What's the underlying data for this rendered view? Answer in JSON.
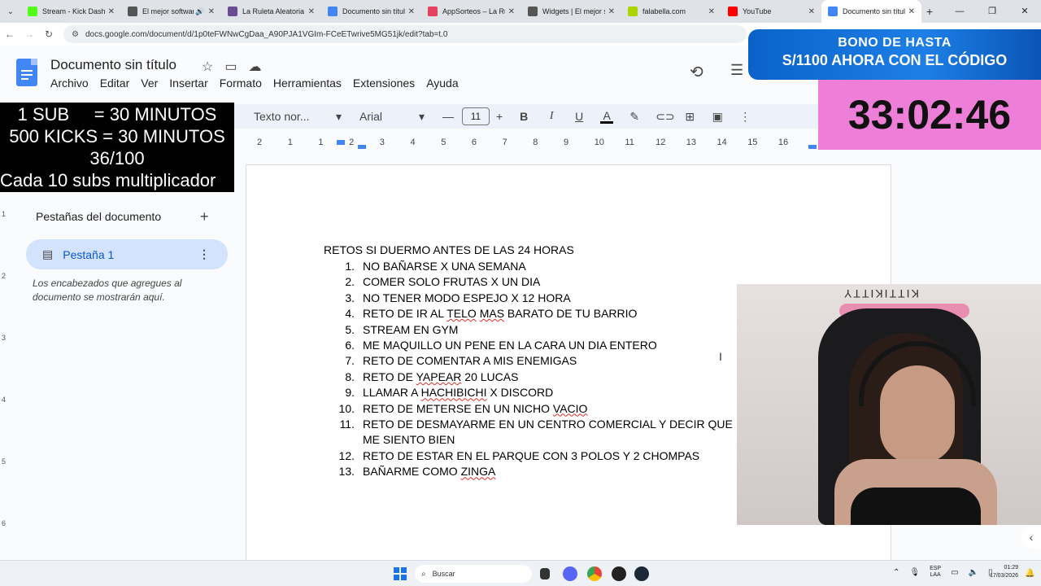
{
  "browser": {
    "tabs": [
      {
        "label": "Stream - Kick Dashbo",
        "fav_color": "#53fc18",
        "active": false
      },
      {
        "label": "El mejor software",
        "fav_color": "#555555",
        "active": false,
        "audio": true
      },
      {
        "label": "La Ruleta Aleatoria",
        "fav_color": "#6a4c93",
        "active": false
      },
      {
        "label": "Documento sin título",
        "fav_color": "#4285f4",
        "active": false
      },
      {
        "label": "AppSorteos – La Rule",
        "fav_color": "#e4405f",
        "active": false
      },
      {
        "label": "Widgets | El mejor so",
        "fav_color": "#555555",
        "active": false
      },
      {
        "label": "falabella.com",
        "fav_color": "#aad500",
        "active": false
      },
      {
        "label": "YouTube",
        "fav_color": "#ff0000",
        "active": false
      },
      {
        "label": "Documento sin título",
        "fav_color": "#4285f4",
        "active": true
      }
    ],
    "url": "docs.google.com/document/d/1p0teFWNwCgDaa_A90PJA1VGIm-FCeETwrive5MG51jk/edit?tab=t.0"
  },
  "docs": {
    "title": "Documento sin título",
    "menu": [
      "Archivo",
      "Editar",
      "Ver",
      "Insertar",
      "Formato",
      "Herramientas",
      "Extensiones",
      "Ayuda"
    ],
    "toolbar": {
      "style": "Texto nor...",
      "font": "Arial",
      "size": "11"
    },
    "ruler_numbers": [
      "2",
      "1",
      "1",
      "2",
      "3",
      "4",
      "5",
      "6",
      "7",
      "8",
      "9",
      "10",
      "11",
      "12",
      "13",
      "14",
      "15",
      "16"
    ],
    "side_panel": {
      "title": "Pestañas del documento",
      "tab_label": "Pestaña 1",
      "hint": "Los encabezados que agregues al documento se mostrarán aquí."
    },
    "heading": "RETOS SI DUERMO ANTES DE LAS 24 HORAS",
    "items": [
      "NO BAÑARSE X UNA SEMANA",
      "COMER SOLO FRUTAS X UN DIA",
      "NO TENER MODO ESPEJO X 12 HORA",
      "RETO DE IR AL TELO MAS BARATO DE TU BARRIO",
      "STREAM EN GYM",
      "ME MAQUILLO UN PENE EN LA CARA UN DIA ENTERO",
      "RETO DE COMENTAR A MIS ENEMIGAS",
      "RETO DE YAPEAR 20 LUCAS",
      "LLAMAR A HACHIBICHI X DISCORD",
      "RETO DE METERSE EN UN NICHO VACIO",
      "RETO DE DESMAYARME EN UN CENTRO COMERCIAL Y DECIR QUE ME SIENTO BIEN",
      "RETO DE ESTAR EN EL PARQUE CON 3 POLOS Y 2 CHOMPAS",
      "BAÑARME COMO ZINGA"
    ]
  },
  "overlay": {
    "goals": [
      "1 SUB     = 30 MINUTOS",
      "500 KICKS = 30 MINUTOS",
      "36/100",
      "Cada 10 subs multiplicador"
    ],
    "promo_line1": "BONO DE HASTA",
    "promo_line2": "S/1100 AHORA CON EL CÓDIGO",
    "timer": "33:02:46",
    "webcam_sign": "KITTIKITTY"
  },
  "taskbar": {
    "search_placeholder": "Buscar",
    "lang": "ESP",
    "lang2": "LAA",
    "time": "01:29",
    "date": "17/03/2026"
  }
}
